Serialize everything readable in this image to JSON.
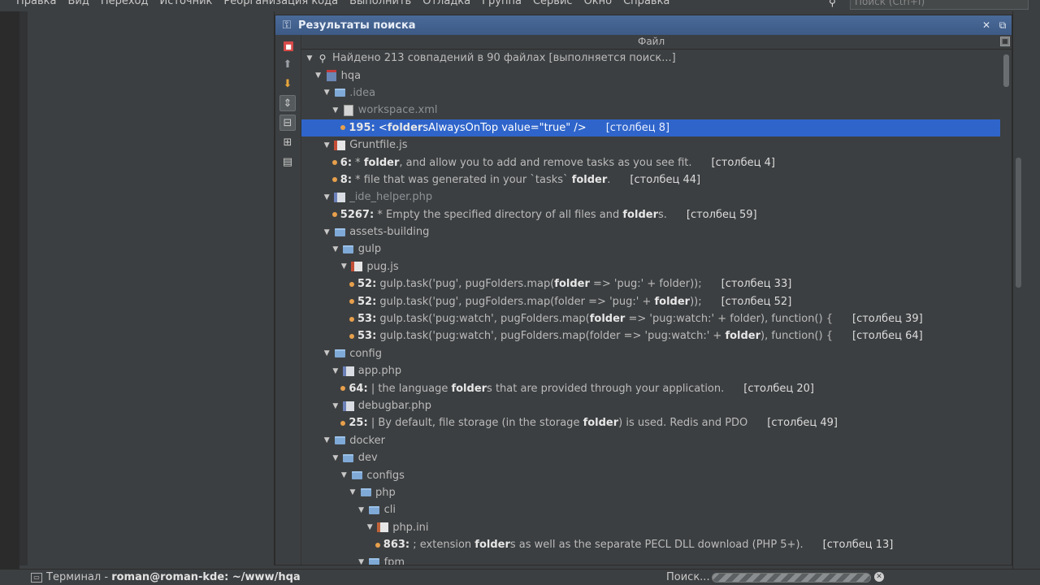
{
  "menu": [
    "Правка",
    "Вид",
    "Переход",
    "Источник",
    "Реорганизация кода",
    "Выполнить",
    "Отладка",
    "Группа",
    "Сервис",
    "Окно",
    "Справка"
  ],
  "global_search": {
    "placeholder": "Поиск (Ctrl+I)",
    "icon": "search-icon"
  },
  "results_window": {
    "title": "Результаты поиска",
    "column_header": "Файл",
    "toolbar": [
      "stop-icon",
      "arrow-up-icon",
      "arrow-down-icon",
      "expand-icon",
      "group-icon",
      "tree-icon",
      "file-icon"
    ]
  },
  "tree": [
    {
      "level": 0,
      "kind": "summary",
      "icon": "mag",
      "text": "Найдено 213 совпадений в 90 файлах [выполняется поиск...]"
    },
    {
      "level": 1,
      "kind": "node",
      "icon": "mod",
      "text": "hqa"
    },
    {
      "level": 2,
      "kind": "node",
      "icon": "folder",
      "text": ".idea",
      "dim": true
    },
    {
      "level": 3,
      "kind": "node",
      "icon": "file",
      "text": "workspace.xml",
      "dim": true
    },
    {
      "level": 4,
      "kind": "match",
      "selected": true,
      "line": "195:",
      "pre": " <",
      "hit": "folder",
      "post": "sAlwaysOnTop value=\"true\" />",
      "col": "[столбец 8]"
    },
    {
      "level": 2,
      "kind": "node",
      "icon": "js",
      "text": "Gruntfile.js"
    },
    {
      "level": 3,
      "kind": "match",
      "line": "6:",
      "pre": " * ",
      "hit": "folder",
      "post": ", and allow you to add and remove tasks as you see fit.",
      "col": "[столбец 4]"
    },
    {
      "level": 3,
      "kind": "match",
      "line": "8:",
      "pre": " * file that was generated in your `tasks` ",
      "hit": "folder",
      "post": ".",
      "col": "[столбец 44]"
    },
    {
      "level": 2,
      "kind": "node",
      "icon": "php",
      "text": "_ide_helper.php",
      "dim": true
    },
    {
      "level": 3,
      "kind": "match",
      "line": "5267:",
      "pre": " * Empty the specified directory of all files and ",
      "hit": "folder",
      "post": "s.",
      "col": "[столбец 59]"
    },
    {
      "level": 2,
      "kind": "node",
      "icon": "folder",
      "text": "assets-building"
    },
    {
      "level": 3,
      "kind": "node",
      "icon": "folder",
      "text": "gulp"
    },
    {
      "level": 4,
      "kind": "node",
      "icon": "js",
      "text": "pug.js"
    },
    {
      "level": 5,
      "kind": "match",
      "line": "52:",
      "pre": " gulp.task('pug', pugFolders.map(",
      "hit": "folder",
      "post": " => 'pug:' + folder));",
      "col": "[столбец 33]"
    },
    {
      "level": 5,
      "kind": "match",
      "line": "52:",
      "pre": " gulp.task('pug', pugFolders.map(folder => 'pug:' + ",
      "hit": "folder",
      "post": "));",
      "col": "[столбец 52]"
    },
    {
      "level": 5,
      "kind": "match",
      "line": "53:",
      "pre": " gulp.task('pug:watch', pugFolders.map(",
      "hit": "folder",
      "post": " => 'pug:watch:' + folder), function() {",
      "col": "[столбец 39]"
    },
    {
      "level": 5,
      "kind": "match",
      "line": "53:",
      "pre": " gulp.task('pug:watch', pugFolders.map(folder => 'pug:watch:' + ",
      "hit": "folder",
      "post": "), function() {",
      "col": "[столбец 64]"
    },
    {
      "level": 2,
      "kind": "node",
      "icon": "folder",
      "text": "config"
    },
    {
      "level": 3,
      "kind": "node",
      "icon": "php",
      "text": "app.php"
    },
    {
      "level": 4,
      "kind": "match",
      "line": "64:",
      "pre": " | the language ",
      "hit": "folder",
      "post": "s that are provided through your application.",
      "col": "[столбец 20]"
    },
    {
      "level": 3,
      "kind": "node",
      "icon": "php",
      "text": "debugbar.php"
    },
    {
      "level": 4,
      "kind": "match",
      "line": "25:",
      "pre": " | By default, file storage (in the storage ",
      "hit": "folder",
      "post": ") is used. Redis and PDO",
      "col": "[столбец 49]"
    },
    {
      "level": 2,
      "kind": "node",
      "icon": "folder",
      "text": "docker"
    },
    {
      "level": 3,
      "kind": "node",
      "icon": "folder",
      "text": "dev"
    },
    {
      "level": 4,
      "kind": "node",
      "icon": "folder",
      "text": "configs"
    },
    {
      "level": 5,
      "kind": "node",
      "icon": "folder",
      "text": "php"
    },
    {
      "level": 6,
      "kind": "node",
      "icon": "folder",
      "text": "cli"
    },
    {
      "level": 7,
      "kind": "node",
      "icon": "ini",
      "text": "php.ini"
    },
    {
      "level": 8,
      "kind": "match",
      "line": "863:",
      "pre": " ; extension ",
      "hit": "folder",
      "post": "s as well as the separate PECL DLL download (PHP 5+).",
      "col": "[столбец 13]"
    },
    {
      "level": 6,
      "kind": "node",
      "icon": "folder",
      "text": "fpm"
    }
  ],
  "statusbar": {
    "terminal_prefix": "Терминал - ",
    "terminal_session": "roman@roman-kde: ~/www/hqa",
    "search_label": "Поиск...",
    "progress_state": "indeterminate"
  }
}
